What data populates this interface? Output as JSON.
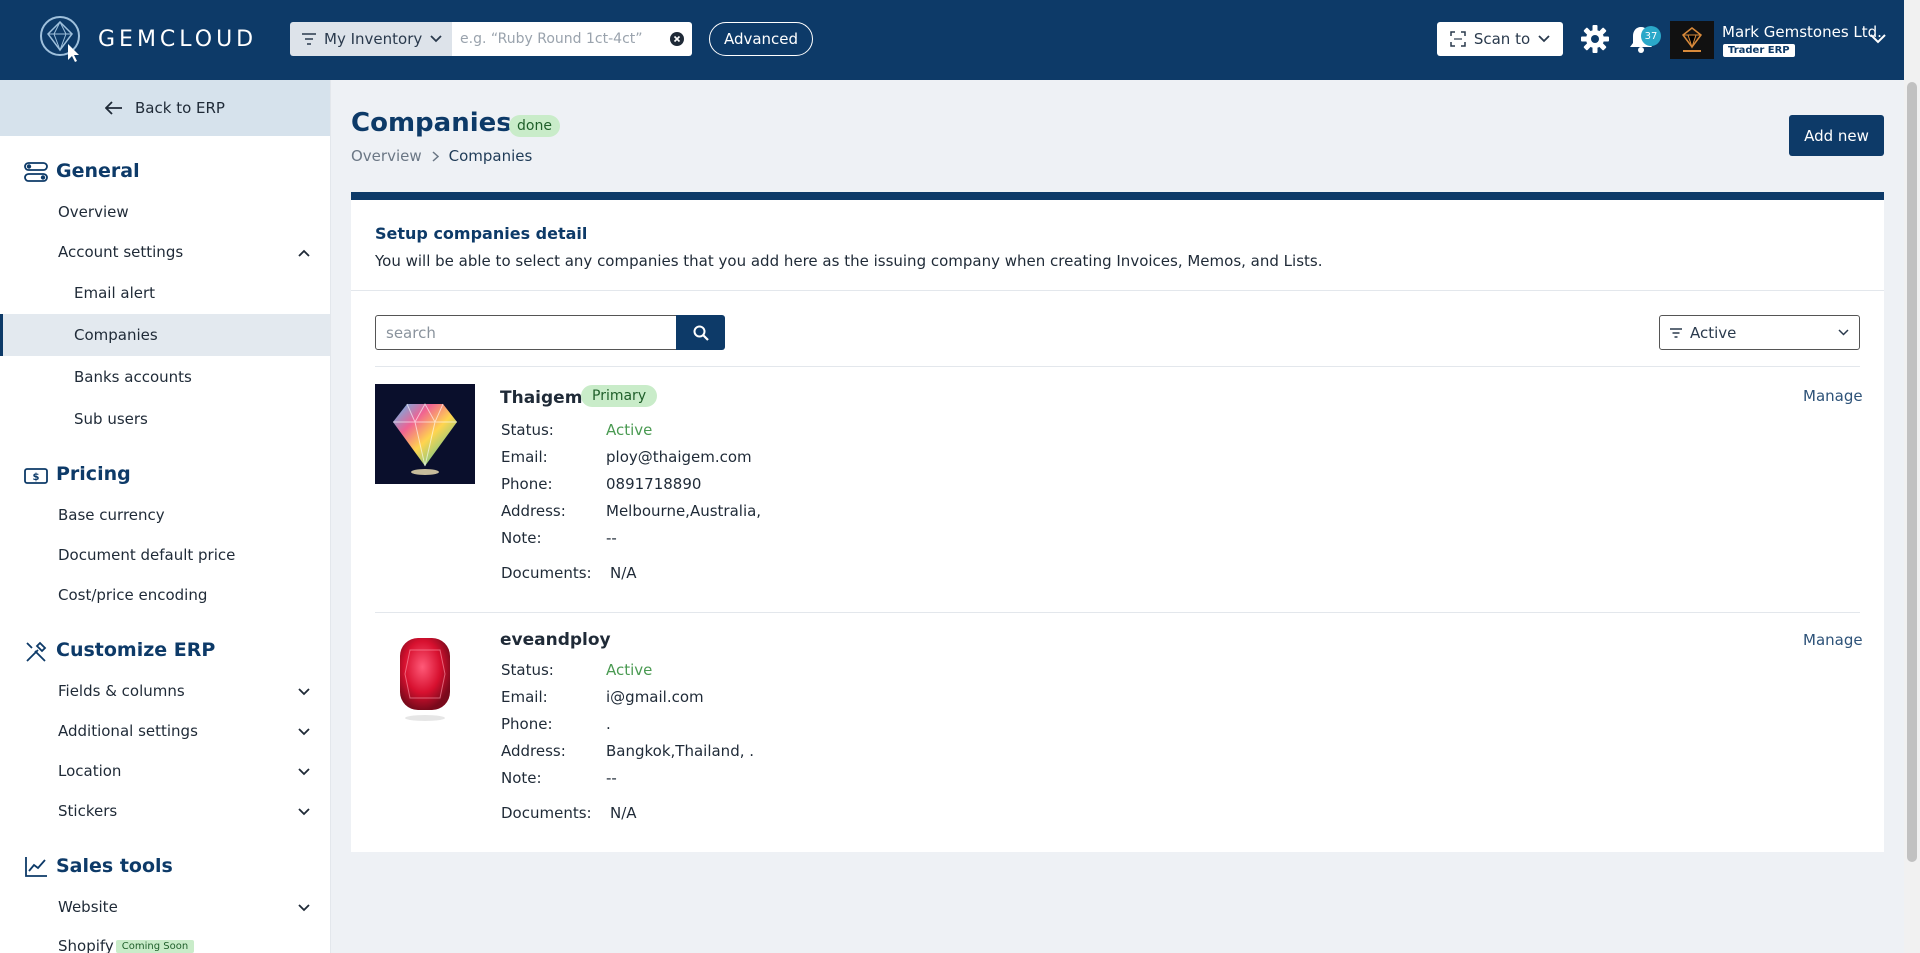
{
  "header": {
    "logo_text": "GEMCLOUD",
    "inventory_label": "My Inventory",
    "search_placeholder": "e.g. “Ruby Round 1ct-4ct”",
    "advanced_label": "Advanced",
    "scan_label": "Scan to",
    "notification_count": "37",
    "user_name": "Mark Gemstones Ltd.",
    "user_role": "Trader ERP"
  },
  "sidebar": {
    "back_label": "Back to ERP",
    "sections": {
      "general": {
        "title": "General",
        "overview": "Overview",
        "account_settings": "Account settings",
        "email_alert": "Email alert",
        "companies": "Companies",
        "banks": "Banks accounts",
        "sub_users": "Sub users"
      },
      "pricing": {
        "title": "Pricing",
        "base_currency": "Base currency",
        "doc_default_price": "Document default price",
        "cost_encoding": "Cost/price encoding"
      },
      "customize": {
        "title": "Customize ERP",
        "fields": "Fields & columns",
        "additional": "Additional settings",
        "location": "Location",
        "stickers": "Stickers"
      },
      "sales": {
        "title": "Sales tools",
        "website": "Website",
        "shopify": "Shopify",
        "coming_soon": "Coming Soon"
      }
    }
  },
  "main": {
    "title": "Companies",
    "status_badge": "done",
    "breadcrumb": {
      "root": "Overview",
      "current": "Companies"
    },
    "add_new_label": "Add new",
    "card": {
      "heading": "Setup companies detail",
      "description": "You will be able to select any companies that you add here as the issuing company when creating Invoices, Memos, and Lists.",
      "search_placeholder": "search",
      "filter_value": "Active"
    },
    "labels": {
      "status": "Status:",
      "email": "Email:",
      "phone": "Phone:",
      "address": "Address:",
      "note": "Note:",
      "documents": "Documents:",
      "manage": "Manage",
      "primary": "Primary"
    },
    "companies": [
      {
        "name": "Thaigem",
        "status": "Active",
        "email": "ploy@thaigem.com",
        "phone": "0891718890",
        "address": "Melbourne,Australia,",
        "note": "--",
        "documents": "N/A"
      },
      {
        "name": "eveandploy",
        "status": "Active",
        "email": "i@gmail.com",
        "phone": ".",
        "address": "Bangkok,Thailand, .",
        "note": "--",
        "documents": "N/A"
      }
    ]
  },
  "colors": {
    "primary": "#0d3a68",
    "badge_green_bg": "#c9ecc9",
    "active_text": "#4a9a52",
    "notification_badge": "#2aa8c9"
  }
}
